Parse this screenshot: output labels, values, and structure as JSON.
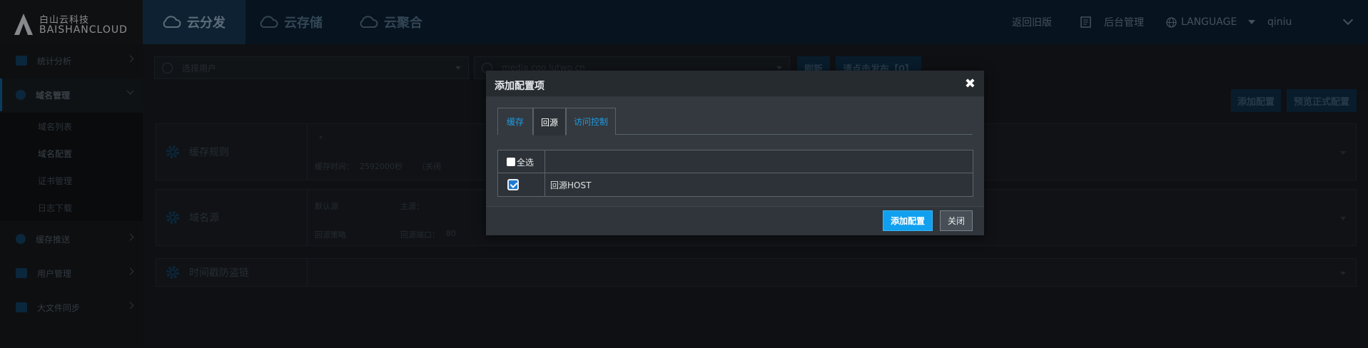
{
  "brand": {
    "name_cn": "白山云科技",
    "name_en": "BAISHANCLOUD"
  },
  "top_nav": {
    "tabs": [
      {
        "label": "云分发",
        "active": true
      },
      {
        "label": "云存储",
        "active": false
      },
      {
        "label": "云聚合",
        "active": false
      }
    ],
    "old_version": "返回旧版",
    "admin": "后台管理",
    "language": "LANGUAGE",
    "user": "qiniu"
  },
  "sidebar": {
    "items": [
      {
        "label": "统计分析",
        "icon": "bar-chart-icon"
      },
      {
        "label": "域名管理",
        "icon": "globe-icon",
        "open": true
      },
      {
        "label": "缓存推送",
        "icon": "refresh-icon"
      },
      {
        "label": "用户管理",
        "icon": "users-icon"
      },
      {
        "label": "大文件同步",
        "icon": "folder-icon"
      }
    ],
    "sub_items": [
      {
        "label": "域名列表"
      },
      {
        "label": "域名配置",
        "active": true
      },
      {
        "label": "证书管理"
      },
      {
        "label": "日志下载"
      }
    ]
  },
  "toolbar": {
    "user_select_placeholder": "选择用户",
    "domain_select_value": "media.coo.lutwo.cn",
    "refresh": "刷新",
    "publish": "请点击发布【0】",
    "add_config": "添加配置",
    "preview": "预览正式配置"
  },
  "panels": {
    "cache": {
      "title": "缓存规则",
      "pattern": "*",
      "cache_time_label": "缓存时间：",
      "cache_time_value": "2592000秒",
      "status": "（关闭"
    },
    "origin": {
      "title": "域名源",
      "default_source": "默认源",
      "primary": "主源：",
      "strategy": "回源策略",
      "port_label": "回源端口：",
      "port_value": "80"
    },
    "hotlink": {
      "title": "时间戳防盗链"
    }
  },
  "modal": {
    "title": "添加配置项",
    "close_glyph": "✖",
    "tabs": [
      {
        "label": "缓存",
        "active": false
      },
      {
        "label": "回源",
        "active": true
      },
      {
        "label": "访问控制",
        "active": false
      }
    ],
    "select_all": "全选",
    "options": [
      {
        "label": "回源HOST",
        "checked": true
      }
    ],
    "confirm": "添加配置",
    "cancel": "关闭"
  },
  "colors": {
    "accent": "#11a0ef",
    "tab_link": "#1f9ae0",
    "modal_bg": "#33393f",
    "page_bg": "#171a1e"
  }
}
